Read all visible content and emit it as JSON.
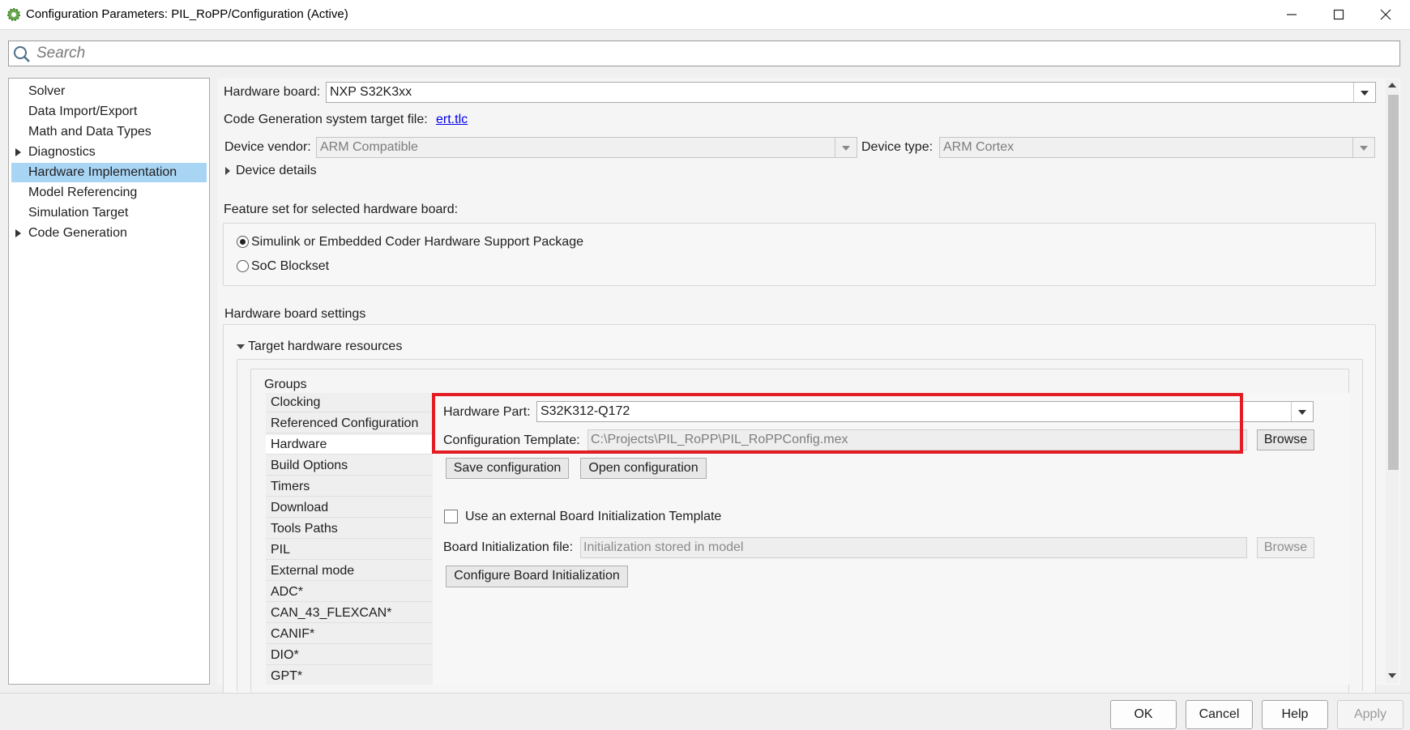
{
  "window": {
    "title": "Configuration Parameters: PIL_RoPP/Configuration (Active)",
    "app_icon": "simulink-gear-icon"
  },
  "search": {
    "placeholder": "Search",
    "value": ""
  },
  "tree": {
    "items": [
      {
        "label": "Solver",
        "expandable": false,
        "selected": false
      },
      {
        "label": "Data Import/Export",
        "expandable": false,
        "selected": false
      },
      {
        "label": "Math and Data Types",
        "expandable": false,
        "selected": false
      },
      {
        "label": "Diagnostics",
        "expandable": true,
        "selected": false
      },
      {
        "label": "Hardware Implementation",
        "expandable": false,
        "selected": true
      },
      {
        "label": "Model Referencing",
        "expandable": false,
        "selected": false
      },
      {
        "label": "Simulation Target",
        "expandable": false,
        "selected": false
      },
      {
        "label": "Code Generation",
        "expandable": true,
        "selected": false
      }
    ]
  },
  "hardware": {
    "board_label": "Hardware board:",
    "board_value": "NXP S32K3xx",
    "target_file_label": "Code Generation system target file:",
    "target_file_link": "ert.tlc",
    "vendor_label": "Device vendor:",
    "vendor_value": "ARM Compatible",
    "type_label": "Device type:",
    "type_value": "ARM Cortex",
    "device_details": "Device details",
    "feature_set_label": "Feature set for selected hardware board:",
    "feature_options": [
      {
        "label": "Simulink or Embedded Coder Hardware Support Package",
        "selected": true
      },
      {
        "label": "SoC Blockset",
        "selected": false
      }
    ],
    "board_settings_label": "Hardware board settings",
    "target_resources_label": "Target hardware resources",
    "groups_label": "Groups"
  },
  "groups": [
    {
      "label": "Clocking",
      "selected": false
    },
    {
      "label": "Referenced Configuration",
      "selected": false
    },
    {
      "label": "Hardware",
      "selected": true
    },
    {
      "label": "Build Options",
      "selected": false
    },
    {
      "label": "Timers",
      "selected": false
    },
    {
      "label": "Download",
      "selected": false
    },
    {
      "label": "Tools Paths",
      "selected": false
    },
    {
      "label": "PIL",
      "selected": false
    },
    {
      "label": "External mode",
      "selected": false
    },
    {
      "label": "ADC*",
      "selected": false
    },
    {
      "label": "CAN_43_FLEXCAN*",
      "selected": false
    },
    {
      "label": "CANIF*",
      "selected": false
    },
    {
      "label": "DIO*",
      "selected": false
    },
    {
      "label": "GPT*",
      "selected": false
    }
  ],
  "hw_panel": {
    "part_label": "Hardware Part:",
    "part_value": "S32K312-Q172",
    "template_label": "Configuration Template:",
    "template_value": "C:\\Projects\\PIL_RoPP\\PIL_RoPPConfig.mex",
    "browse_label": "Browse",
    "save_config": "Save configuration",
    "open_config": "Open configuration",
    "external_template_label": "Use an external Board Initialization Template",
    "external_template_checked": false,
    "board_init_label": "Board Initialization file:",
    "board_init_placeholder": "Initialization stored in model",
    "board_init_browse": "Browse",
    "configure_init": "Configure Board Initialization"
  },
  "footer": {
    "ok": "OK",
    "cancel": "Cancel",
    "help": "Help",
    "apply": "Apply"
  },
  "colors": {
    "selection": "#a9d5f5",
    "highlight": "#e31b23",
    "link": "#0000ee"
  }
}
